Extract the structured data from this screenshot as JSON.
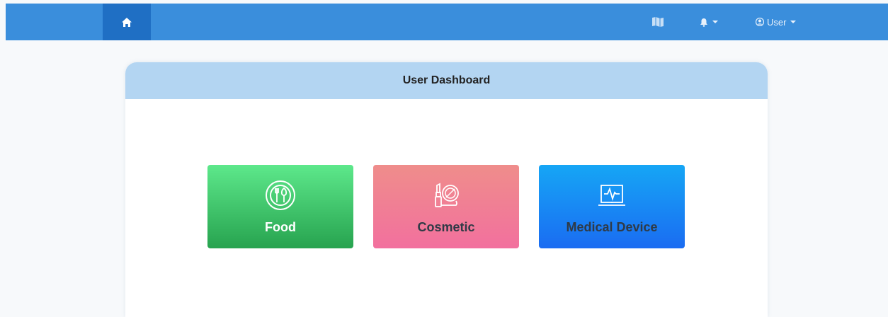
{
  "navbar": {
    "home_icon": "home-icon",
    "book_icon": "map-book-icon",
    "bell_icon": "bell-icon",
    "user_icon": "user-circle-icon",
    "user_label": "User"
  },
  "dashboard": {
    "title": "User Dashboard",
    "tiles": [
      {
        "label": "Food",
        "icon": "utensils-icon"
      },
      {
        "label": "Cosmetic",
        "icon": "lipstick-icon"
      },
      {
        "label": "Medical Device",
        "icon": "heart-monitor-icon"
      }
    ]
  },
  "colors": {
    "navbar": "#3a8edc",
    "home_active": "#1f6fc4",
    "header": "#b3d5f2",
    "food": "#27a34f",
    "cosmetic": "#f2709e",
    "medical": "#1a6cf2"
  }
}
